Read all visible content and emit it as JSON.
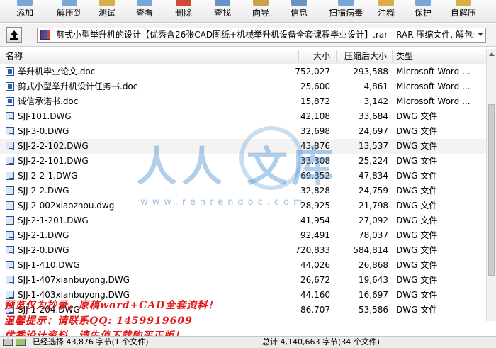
{
  "toolbar": {
    "buttons": [
      {
        "label": "添加",
        "color": "#7aa7d8"
      },
      {
        "label": "解压到",
        "color": "#7aa7d8"
      },
      {
        "label": "测试",
        "color": "#d6b04a"
      },
      {
        "label": "查看",
        "color": "#7aa7d8"
      },
      {
        "label": "删除",
        "color": "#d04a3a"
      },
      {
        "label": "查找",
        "color": "#6a94c8"
      },
      {
        "label": "向导",
        "color": "#c8a24a"
      },
      {
        "label": "信息",
        "color": "#6a94c8"
      },
      {
        "label": "扫描病毒",
        "color": "#7aa7d8"
      },
      {
        "label": "注释",
        "color": "#d6b04a"
      },
      {
        "label": "保护",
        "color": "#7aa7d8"
      },
      {
        "label": "自解压",
        "color": "#d6b04a"
      }
    ]
  },
  "address": {
    "text": "剪式小型举升机的设计【优秀含26张CAD图纸+机械举升机设备全套课程毕业设计】.rar - RAR 压缩文件, 解包大小为"
  },
  "columns": {
    "name": "名称",
    "size": "大小",
    "packed": "压缩后大小",
    "type": "类型"
  },
  "files": [
    {
      "name": "举升机毕业论文.doc",
      "size": "752,027",
      "packed": "293,588",
      "type": "Microsoft Word ...",
      "kind": "doc"
    },
    {
      "name": "剪式小型举升机设计任务书.doc",
      "size": "25,600",
      "packed": "4,861",
      "type": "Microsoft Word ...",
      "kind": "doc"
    },
    {
      "name": "诚信承诺书.doc",
      "size": "15,872",
      "packed": "3,142",
      "type": "Microsoft Word ...",
      "kind": "doc"
    },
    {
      "name": "SJJ-101.DWG",
      "size": "42,108",
      "packed": "33,684",
      "type": "DWG 文件",
      "kind": "dwg"
    },
    {
      "name": "SJJ-3-0.DWG",
      "size": "32,698",
      "packed": "24,697",
      "type": "DWG 文件",
      "kind": "dwg"
    },
    {
      "name": "SJJ-2-2-102.DWG",
      "size": "43,876",
      "packed": "13,537",
      "type": "DWG 文件",
      "kind": "dwg"
    },
    {
      "name": "SJJ-2-2-101.DWG",
      "size": "33,308",
      "packed": "25,224",
      "type": "DWG 文件",
      "kind": "dwg"
    },
    {
      "name": "SJJ-2-2-1.DWG",
      "size": "69,352",
      "packed": "47,834",
      "type": "DWG 文件",
      "kind": "dwg"
    },
    {
      "name": "SJJ-2-2.DWG",
      "size": "32,828",
      "packed": "24,759",
      "type": "DWG 文件",
      "kind": "dwg"
    },
    {
      "name": "SJJ-2-002xiaozhou.dwg",
      "size": "28,925",
      "packed": "21,798",
      "type": "DWG 文件",
      "kind": "dwg"
    },
    {
      "name": "SJJ-2-1-201.DWG",
      "size": "41,954",
      "packed": "27,092",
      "type": "DWG 文件",
      "kind": "dwg"
    },
    {
      "name": "SJJ-2-1.DWG",
      "size": "92,491",
      "packed": "78,037",
      "type": "DWG 文件",
      "kind": "dwg"
    },
    {
      "name": "SJJ-2-0.DWG",
      "size": "720,833",
      "packed": "584,814",
      "type": "DWG 文件",
      "kind": "dwg"
    },
    {
      "name": "SJJ-1-410.DWG",
      "size": "44,026",
      "packed": "26,868",
      "type": "DWG 文件",
      "kind": "dwg"
    },
    {
      "name": "SJJ-1-407xianbuyong.DWG",
      "size": "26,672",
      "packed": "19,643",
      "type": "DWG 文件",
      "kind": "dwg"
    },
    {
      "name": "SJJ-1-403xianbuyong.DWG",
      "size": "44,160",
      "packed": "16,697",
      "type": "DWG 文件",
      "kind": "dwg"
    },
    {
      "name": "SJJ-1-204.DWG",
      "size": "86,707",
      "packed": "53,586",
      "type": "DWG 文件",
      "kind": "dwg"
    }
  ],
  "watermark": {
    "left_text": "人人",
    "right_text": "文库",
    "url": "www.renrendoc.com"
  },
  "promo": {
    "line1": "预览仅为抄录，原稿word+CAD全套资料！",
    "line2": "温馨提示：请联系QQ: 1459919609",
    "line3": "优秀设计资料，请先值下载购买正版！"
  },
  "status": {
    "selected": "已经选择 43,876 字节(1 个文件)",
    "total": "总计 4,140,663 字节(34 个文件)"
  }
}
